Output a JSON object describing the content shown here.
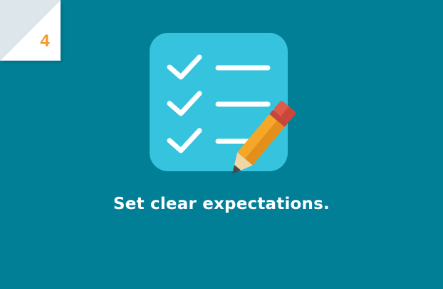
{
  "step": {
    "number": "4"
  },
  "card": {
    "caption": "Set clear expectations.",
    "icon": "checklist-with-pencil-icon"
  },
  "colors": {
    "background": "#017f96",
    "outer": "#dde6ea",
    "fold": "#ffffff",
    "number": "#f39a2c",
    "icon_tile": "#36c3de",
    "pencil_body": "#f4a728",
    "pencil_eraser": "#e05a4a"
  }
}
